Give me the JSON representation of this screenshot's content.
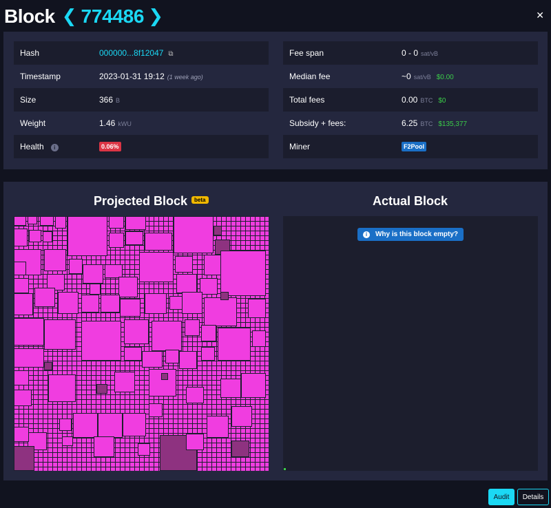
{
  "header": {
    "title": "Block",
    "prev_icon": "chevron-left-icon",
    "height": "774486",
    "next_icon": "chevron-right-icon",
    "close_icon": "close-icon"
  },
  "details": {
    "left": [
      {
        "label": "Hash",
        "value": "000000...8f12047",
        "copy_icon": "copy-icon"
      },
      {
        "label": "Timestamp",
        "value": "2023-01-31 19:12",
        "ago": "(1 week ago)"
      },
      {
        "label": "Size",
        "value": "366",
        "unit": "B"
      },
      {
        "label": "Weight",
        "value": "1.46",
        "unit": "kWU"
      },
      {
        "label": "Health",
        "badge": "0.06%",
        "info_icon": "info-icon"
      }
    ],
    "right": [
      {
        "label": "Fee span",
        "value": "0 - 0",
        "unit": "sat/vB"
      },
      {
        "label": "Median fee",
        "value": "~0",
        "unit": "sat/vB",
        "fiat": "$0.00"
      },
      {
        "label": "Total fees",
        "value": "0.00",
        "unit": "BTC",
        "fiat": "$0"
      },
      {
        "label": "Subsidy + fees:",
        "value": "6.25",
        "unit": "BTC",
        "fiat": "$135,377"
      },
      {
        "label": "Miner",
        "badge": "F2Pool"
      }
    ]
  },
  "blocks": {
    "projected_title": "Projected Block",
    "beta_label": "beta",
    "actual_title": "Actual Block",
    "empty_button": "Why is this block empty?",
    "colors": {
      "tx": "#f03de0",
      "tx_dim": "#8e3280"
    }
  },
  "footer": {
    "audit_label": "Audit",
    "details_label": "Details"
  }
}
